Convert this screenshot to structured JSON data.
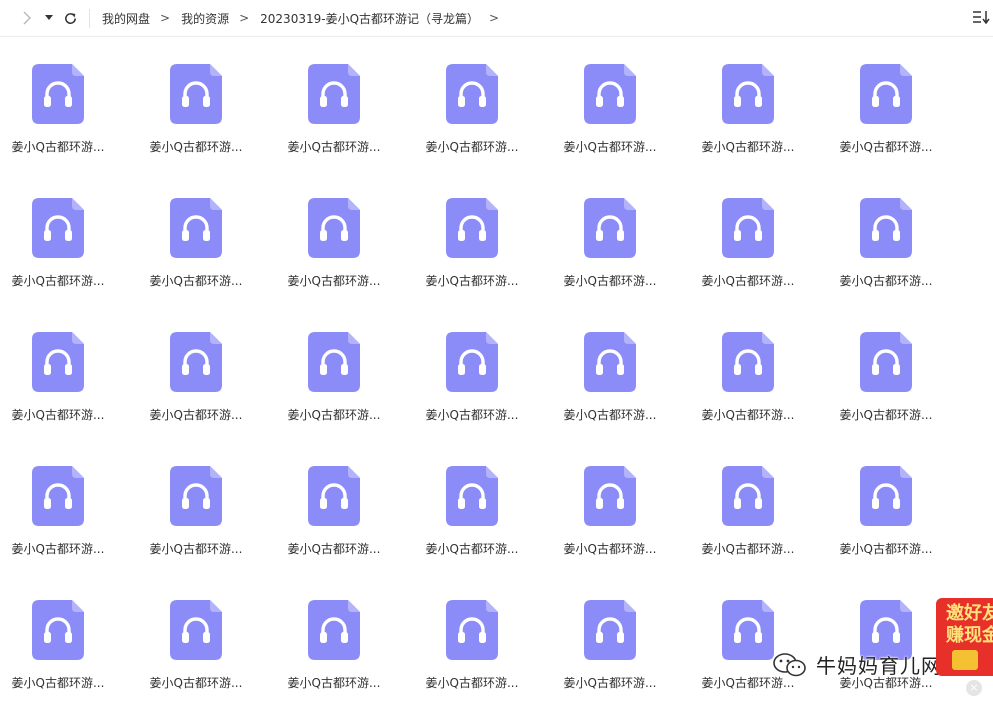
{
  "toolbar": {
    "forward_icon": "chevron-right-icon",
    "history_icon": "caret-down-icon",
    "refresh_icon": "refresh-icon",
    "sort_icon": "sort-list-icon",
    "breadcrumbs": [
      "我的网盘",
      "我的资源",
      "20230319-姜小Q古都环游记（寻龙篇）"
    ],
    "separator": ">"
  },
  "files": {
    "icon": "audio-file-icon",
    "icon_color": "#8c8cf8",
    "items": [
      "姜小Q古都环游...",
      "姜小Q古都环游...",
      "姜小Q古都环游...",
      "姜小Q古都环游...",
      "姜小Q古都环游...",
      "姜小Q古都环游...",
      "姜小Q古都环游...",
      "姜小Q古都环游...",
      "姜小Q古都环游...",
      "姜小Q古都环游...",
      "姜小Q古都环游...",
      "姜小Q古都环游...",
      "姜小Q古都环游...",
      "姜小Q古都环游...",
      "姜小Q古都环游...",
      "姜小Q古都环游...",
      "姜小Q古都环游...",
      "姜小Q古都环游...",
      "姜小Q古都环游...",
      "姜小Q古都环游...",
      "姜小Q古都环游...",
      "姜小Q古都环游...",
      "姜小Q古都环游...",
      "姜小Q古都环游...",
      "姜小Q古都环游...",
      "姜小Q古都环游...",
      "姜小Q古都环游...",
      "姜小Q古都环游...",
      "姜小Q古都环游...",
      "姜小Q古都环游...",
      "姜小Q古都环游...",
      "姜小Q古都环游...",
      "姜小Q古都环游...",
      "姜小Q古都环游...",
      "姜小Q古都环游..."
    ]
  },
  "promo": {
    "line1": "邀好友",
    "line2": "赚现金",
    "close": "×",
    "bg_color": "#e7302a"
  },
  "watermark": {
    "icon": "wechat-icon",
    "text": "牛妈妈育儿网"
  }
}
